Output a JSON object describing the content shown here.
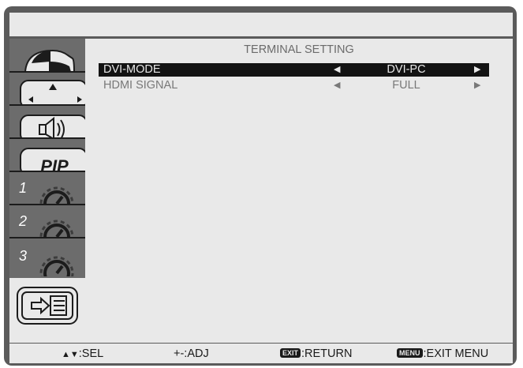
{
  "menu": {
    "title": "TERMINAL SETTING",
    "rows": [
      {
        "label": "DVI-MODE",
        "value": "DVI-PC",
        "left_arrow": "◀",
        "right_arrow": "▶",
        "selected": true
      },
      {
        "label": "HDMI SIGNAL",
        "value": "FULL",
        "left_arrow": "◀",
        "right_arrow": "▶",
        "selected": false
      }
    ]
  },
  "sidebar": {
    "tabs": [
      {
        "icon": "picture-icon",
        "number": ""
      },
      {
        "icon": "screen-position-icon",
        "number": ""
      },
      {
        "icon": "audio-icon",
        "number": ""
      },
      {
        "icon": "pip-icon",
        "number": "",
        "text": "PIP"
      },
      {
        "icon": "config-1-icon",
        "number": "1"
      },
      {
        "icon": "config-2-icon",
        "number": "2"
      },
      {
        "icon": "config-3-icon",
        "number": "3"
      },
      {
        "icon": "input-icon",
        "number": "",
        "selected": true
      }
    ]
  },
  "bottom": {
    "sel_symbol": "▲▼",
    "sel_label": ":SEL",
    "adj_label": "+-:ADJ",
    "exit_key": "EXIT",
    "return_label": ":RETURN",
    "menu_key": "MENU",
    "exit_menu_label": ":EXIT MENU"
  },
  "colors": {
    "panel": "#e9e9e9",
    "frame": "#5b5b5b",
    "sidebar": "#6c6c6c",
    "selected_row": "#131313"
  }
}
